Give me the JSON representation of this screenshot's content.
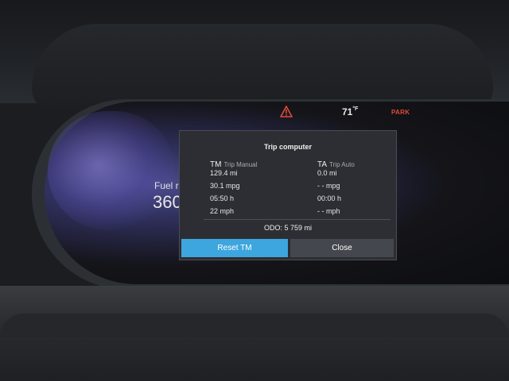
{
  "status_bar": {
    "warning_icon": "warning-triangle-icon",
    "warning_color": "#e04a3a",
    "temperature": "71",
    "temperature_unit": "°F",
    "gear": "PARK"
  },
  "gauge": {
    "fuel_label": "Fuel ra",
    "fuel_value": "360"
  },
  "trip_computer": {
    "title": "Trip computer",
    "columns": [
      {
        "code": "TM",
        "name": "Trip Manual",
        "distance": "129.4 mi",
        "consumption": "30.1 mpg",
        "time": "05:50 h",
        "speed": "22 mph"
      },
      {
        "code": "TA",
        "name": "Trip Auto",
        "distance": "0.0 mi",
        "consumption": "- - mpg",
        "time": "00:00 h",
        "speed": "- - mph"
      }
    ],
    "odometer": "ODO:  5 759 mi",
    "buttons": {
      "reset": "Reset TM",
      "close": "Close"
    },
    "accent_color": "#3ea6de"
  }
}
